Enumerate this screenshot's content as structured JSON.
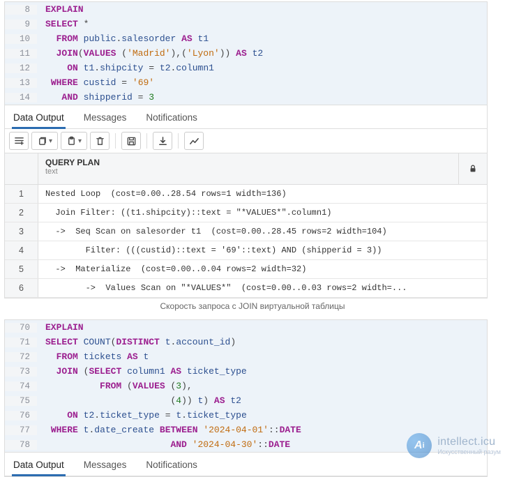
{
  "block1": {
    "lines": [
      {
        "n": "8",
        "html": "<span class='kw'>EXPLAIN</span>"
      },
      {
        "n": "9",
        "html": "<span class='kw'>SELECT</span> <span class='op'>*</span>"
      },
      {
        "n": "10",
        "html": "  <span class='kw'>FROM</span> <span class='ident'>public</span><span class='op'>.</span><span class='ident'>salesorder</span> <span class='kw'>AS</span> <span class='ident'>t1</span>"
      },
      {
        "n": "11",
        "html": "  <span class='kw'>JOIN</span><span class='op'>(</span><span class='kw'>VALUES</span> <span class='op'>(</span><span class='str'>'Madrid'</span><span class='op'>),(</span><span class='str'>'Lyon'</span><span class='op'>))</span> <span class='kw'>AS</span> <span class='ident'>t2</span>"
      },
      {
        "n": "12",
        "html": "    <span class='kw'>ON</span> <span class='ident'>t1</span><span class='op'>.</span><span class='ident'>shipcity</span> <span class='op'>=</span> <span class='ident'>t2</span><span class='op'>.</span><span class='ident'>column1</span>"
      },
      {
        "n": "13",
        "html": " <span class='kw'>WHERE</span> <span class='ident'>custid</span> <span class='op'>=</span> <span class='str'>'69'</span>"
      },
      {
        "n": "14",
        "html": "   <span class='kw'>AND</span> <span class='ident'>shipperid</span> <span class='op'>=</span> <span class='num'>3</span>"
      }
    ],
    "tabs": [
      "Data Output",
      "Messages",
      "Notifications"
    ],
    "activeTab": 0,
    "column": {
      "title": "QUERY PLAN",
      "subtitle": "text"
    },
    "rows": [
      "Nested Loop  (cost=0.00..28.54 rows=1 width=136)",
      "  Join Filter: ((t1.shipcity)::text = \"*VALUES*\".column1)",
      "  ->  Seq Scan on salesorder t1  (cost=0.00..28.45 rows=2 width=104)",
      "        Filter: (((custid)::text = '69'::text) AND (shipperid = 3))",
      "  ->  Materialize  (cost=0.00..0.04 rows=2 width=32)",
      "        ->  Values Scan on \"*VALUES*\"  (cost=0.00..0.03 rows=2 width=..."
    ]
  },
  "caption": "Скорость запроса с JOIN виртуальной таблицы",
  "block2": {
    "lines": [
      {
        "n": "70",
        "html": "<span class='kw'>EXPLAIN</span>"
      },
      {
        "n": "71",
        "html": "<span class='kw'>SELECT</span> <span class='func'>COUNT</span><span class='op'>(</span><span class='kw'>DISTINCT</span> <span class='ident'>t</span><span class='op'>.</span><span class='ident'>account_id</span><span class='op'>)</span>"
      },
      {
        "n": "72",
        "html": "  <span class='kw'>FROM</span> <span class='ident'>tickets</span> <span class='kw'>AS</span> <span class='ident'>t</span>"
      },
      {
        "n": "73",
        "html": "  <span class='kw'>JOIN</span> <span class='op'>(</span><span class='kw'>SELECT</span> <span class='ident'>column1</span> <span class='kw'>AS</span> <span class='ident'>ticket_type</span>"
      },
      {
        "n": "74",
        "html": "          <span class='kw'>FROM</span> <span class='op'>(</span><span class='kw'>VALUES</span> <span class='op'>(</span><span class='num'>3</span><span class='op'>),</span>"
      },
      {
        "n": "75",
        "html": "                       <span class='op'>(</span><span class='num'>4</span><span class='op'>))</span> <span class='ident'>t</span><span class='op'>)</span> <span class='kw'>AS</span> <span class='ident'>t2</span>"
      },
      {
        "n": "76",
        "html": "    <span class='kw'>ON</span> <span class='ident'>t2</span><span class='op'>.</span><span class='ident'>ticket_type</span> <span class='op'>=</span> <span class='ident'>t</span><span class='op'>.</span><span class='ident'>ticket_type</span>"
      },
      {
        "n": "77",
        "html": " <span class='kw'>WHERE</span> <span class='ident'>t</span><span class='op'>.</span><span class='ident'>date_create</span> <span class='kw'>BETWEEN</span> <span class='str'>'2024-04-01'</span><span class='op'>::</span><span class='kw'>DATE</span>"
      },
      {
        "n": "78",
        "html": "                       <span class='kw'>AND</span> <span class='str'>'2024-04-30'</span><span class='op'>::</span><span class='kw'>DATE</span>"
      }
    ],
    "tabs": [
      "Data Output",
      "Messages",
      "Notifications"
    ],
    "activeTab": 0
  },
  "watermark": {
    "name": "intellect.icu",
    "tagline": "Искусственный разум"
  },
  "toolbarIcons": [
    "add-row",
    "copy",
    "paste",
    "delete",
    "save",
    "download",
    "chart"
  ]
}
